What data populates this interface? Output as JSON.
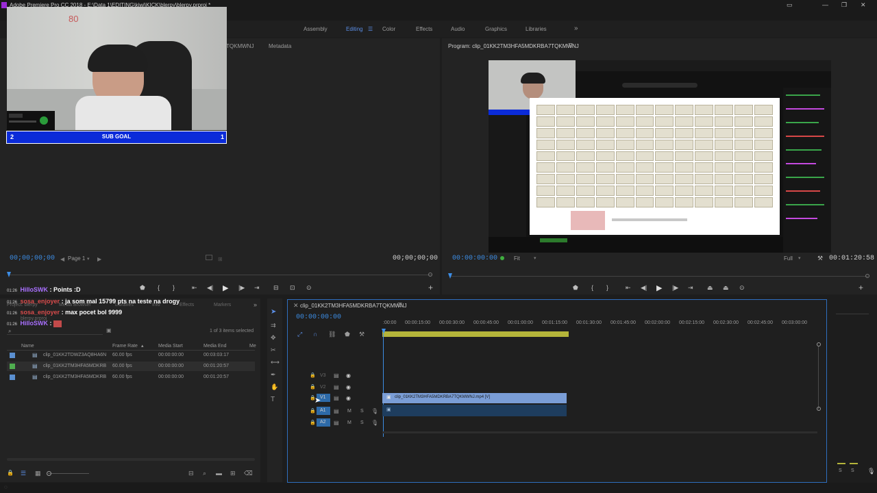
{
  "window": {
    "title": "Adobe Premiere Pro CC 2018 - E:\\Data 1\\EDITING\\kiwi\\KICK\\blerpy\\blerpy.prproj *"
  },
  "workspaces": [
    "Assembly",
    "Editing",
    "Color",
    "Effects",
    "Audio",
    "Graphics",
    "Libraries"
  ],
  "active_workspace": "Editing",
  "source_panel": {
    "tabs": [
      "TQKMWNJ",
      "Metadata"
    ],
    "timecode_left": "00;00;00;00",
    "page": "Page 1",
    "timecode_right": "00;00;00;00"
  },
  "program_panel": {
    "title": "Program: clip_01KK2TM3HFA5MDKRBA7TQKMWNJ",
    "timecode": "00:00:00:00",
    "fit": "Fit",
    "quality": "Full",
    "duration": "00:01:20:58"
  },
  "webcam_overlay": {
    "number": "80",
    "sub_goal_label": "SUB GOAL",
    "left_count": "2",
    "right_count": "1"
  },
  "chat_overlay": [
    {
      "time": "01:26",
      "name": "HilloSWK",
      "sep": " : ",
      "msg": "Points :D",
      "nameColor": "#a970ff"
    },
    {
      "time": "01:26",
      "name": "sosa_enjoyer",
      "sep": " : ",
      "msg": "ja som mal 15799 pts na teste na drogy",
      "nameColor": "#d84b4b"
    },
    {
      "time": "01:26",
      "name": "sosa_enjoyer",
      "sep": " : ",
      "msg": "max pocet bol 9999",
      "nameColor": "#d84b4b"
    },
    {
      "time": "01:26",
      "name": "HilloSWK",
      "sep": " : ",
      "msg": "",
      "nameColor": "#a970ff"
    }
  ],
  "project_panel": {
    "tabs": [
      "Project: blerpy",
      "Media Browser",
      "Libraries",
      "Info",
      "Effects",
      "Markers"
    ],
    "file_name": "blerpy.prproj",
    "items_selected": "1 of 3 items selected",
    "columns": [
      "Name",
      "Frame Rate",
      "Media Start",
      "Media End",
      "Me"
    ],
    "rows": [
      {
        "name": "clip_01KK2TDWZ3AQ8HA6N",
        "fps": "60.00 fps",
        "start": "00:00:00:00",
        "end": "00:03:03:17",
        "color": "#5a8fd0"
      },
      {
        "name": "clip_01KK2TM3HFA5MDKRB",
        "fps": "60.00 fps",
        "start": "00:00:00:00",
        "end": "00:01:20:57",
        "color": "#4fae4f"
      },
      {
        "name": "clip_01KK2TM3HFA5MDKRB",
        "fps": "60.00 fps",
        "start": "00:00:00:00",
        "end": "00:01:20:57",
        "color": "#5a8fd0"
      }
    ]
  },
  "timeline": {
    "sequence_name": "clip_01KK2TM3HFA5MDKRBA7TQKMWNJ",
    "timecode": "00:00:00:00",
    "ruler": [
      ":00:00",
      "00:00:15:00",
      "00:00:30:00",
      "00:00:45:00",
      "00:01:00:00",
      "00:01:15:00",
      "00:01:30:00",
      "00:01:45:00",
      "00:02:00:00",
      "00:02:15:00",
      "00:02:30:00",
      "00:02:45:00",
      "00:03:00:00"
    ],
    "video_tracks": [
      "V3",
      "V2",
      "V1"
    ],
    "audio_tracks": [
      "A1",
      "A2"
    ],
    "clip_label": "clip_01KK2TM3HFA5MDKRBA7TQKMWNJ.mp4 [V]",
    "track_buttons": {
      "mute": "M",
      "solo": "S"
    }
  },
  "meter": {
    "labels": [
      "S",
      "S"
    ]
  }
}
